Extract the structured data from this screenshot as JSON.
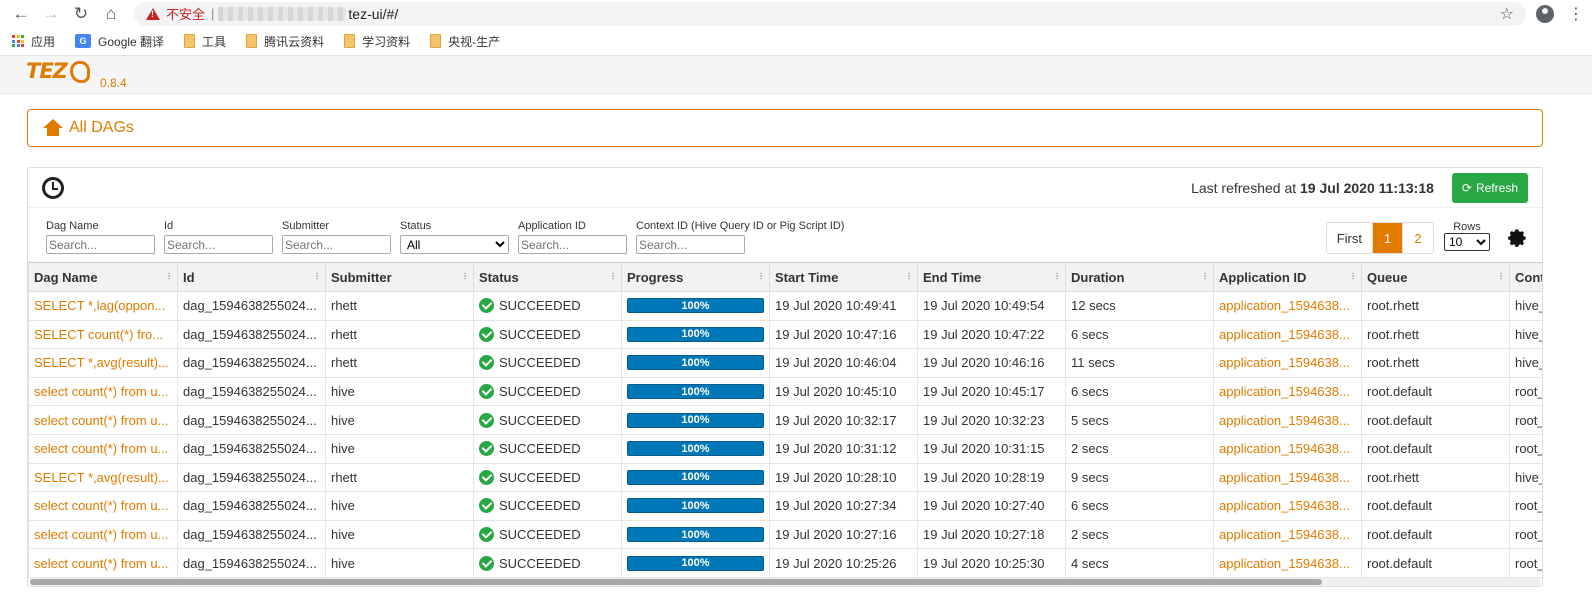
{
  "browser": {
    "insecure_label": "不安全",
    "url": "tez-ui/#/"
  },
  "bookmarks": [
    {
      "label": "应用",
      "icon": "apps-icon"
    },
    {
      "label": "Google 翻译",
      "icon": "google-translate-icon"
    },
    {
      "label": "工具",
      "icon": "folder-icon"
    },
    {
      "label": "腾讯云资料",
      "icon": "folder-icon"
    },
    {
      "label": "学习资料",
      "icon": "folder-icon"
    },
    {
      "label": "央视-生产",
      "icon": "folder-icon"
    }
  ],
  "app": {
    "logo_text": "TEZ",
    "version": "0.8.4"
  },
  "breadcrumb": {
    "title": "All DAGs"
  },
  "toolbar": {
    "last_refreshed_prefix": "Last refreshed at ",
    "last_refreshed_time": "19 Jul 2020 11:13:18",
    "refresh_label": "Refresh"
  },
  "filters": [
    {
      "label": "Dag Name",
      "placeholder": "Search..."
    },
    {
      "label": "Id",
      "placeholder": "Search..."
    },
    {
      "label": "Submitter",
      "placeholder": "Search..."
    },
    {
      "label": "Status",
      "selected": "All"
    },
    {
      "label": "Application ID",
      "placeholder": "Search..."
    },
    {
      "label": "Context ID (Hive Query ID or Pig Script ID)",
      "placeholder": "Search..."
    }
  ],
  "pager": {
    "first_label": "First",
    "current_page": "1",
    "next_page": "2",
    "rows_label": "Rows",
    "rows_value": "10"
  },
  "table": {
    "columns": [
      "Dag Name",
      "Id",
      "Submitter",
      "Status",
      "Progress",
      "Start Time",
      "End Time",
      "Duration",
      "Application ID",
      "Queue",
      "Conte"
    ],
    "rows": [
      {
        "dag_name": "SELECT *,lag(oppon...",
        "id": "dag_1594638255024...",
        "submitter": "rhett",
        "status": "SUCCEEDED",
        "progress": "100%",
        "start": "19 Jul 2020 10:49:41",
        "end": "19 Jul 2020 10:49:54",
        "duration": "12 secs",
        "app_id": "application_1594638...",
        "queue": "root.rhett",
        "context": "hive_"
      },
      {
        "dag_name": "SELECT count(*) fro...",
        "id": "dag_1594638255024...",
        "submitter": "rhett",
        "status": "SUCCEEDED",
        "progress": "100%",
        "start": "19 Jul 2020 10:47:16",
        "end": "19 Jul 2020 10:47:22",
        "duration": "6 secs",
        "app_id": "application_1594638...",
        "queue": "root.rhett",
        "context": "hive_"
      },
      {
        "dag_name": "SELECT *,avg(result)...",
        "id": "dag_1594638255024...",
        "submitter": "rhett",
        "status": "SUCCEEDED",
        "progress": "100%",
        "start": "19 Jul 2020 10:46:04",
        "end": "19 Jul 2020 10:46:16",
        "duration": "11 secs",
        "app_id": "application_1594638...",
        "queue": "root.rhett",
        "context": "hive_"
      },
      {
        "dag_name": "select count(*) from u...",
        "id": "dag_1594638255024...",
        "submitter": "hive",
        "status": "SUCCEEDED",
        "progress": "100%",
        "start": "19 Jul 2020 10:45:10",
        "end": "19 Jul 2020 10:45:17",
        "duration": "6 secs",
        "app_id": "application_1594638...",
        "queue": "root.default",
        "context": "root_"
      },
      {
        "dag_name": "select count(*) from u...",
        "id": "dag_1594638255024...",
        "submitter": "hive",
        "status": "SUCCEEDED",
        "progress": "100%",
        "start": "19 Jul 2020 10:32:17",
        "end": "19 Jul 2020 10:32:23",
        "duration": "5 secs",
        "app_id": "application_1594638...",
        "queue": "root.default",
        "context": "root_"
      },
      {
        "dag_name": "select count(*) from u...",
        "id": "dag_1594638255024...",
        "submitter": "hive",
        "status": "SUCCEEDED",
        "progress": "100%",
        "start": "19 Jul 2020 10:31:12",
        "end": "19 Jul 2020 10:31:15",
        "duration": "2 secs",
        "app_id": "application_1594638...",
        "queue": "root.default",
        "context": "root_"
      },
      {
        "dag_name": "SELECT *,avg(result)...",
        "id": "dag_1594638255024...",
        "submitter": "rhett",
        "status": "SUCCEEDED",
        "progress": "100%",
        "start": "19 Jul 2020 10:28:10",
        "end": "19 Jul 2020 10:28:19",
        "duration": "9 secs",
        "app_id": "application_1594638...",
        "queue": "root.rhett",
        "context": "hive_"
      },
      {
        "dag_name": "select count(*) from u...",
        "id": "dag_1594638255024...",
        "submitter": "hive",
        "status": "SUCCEEDED",
        "progress": "100%",
        "start": "19 Jul 2020 10:27:34",
        "end": "19 Jul 2020 10:27:40",
        "duration": "6 secs",
        "app_id": "application_1594638...",
        "queue": "root.default",
        "context": "root_"
      },
      {
        "dag_name": "select count(*) from u...",
        "id": "dag_1594638255024...",
        "submitter": "hive",
        "status": "SUCCEEDED",
        "progress": "100%",
        "start": "19 Jul 2020 10:27:16",
        "end": "19 Jul 2020 10:27:18",
        "duration": "2 secs",
        "app_id": "application_1594638...",
        "queue": "root.default",
        "context": "root_"
      },
      {
        "dag_name": "select count(*) from u...",
        "id": "dag_1594638255024...",
        "submitter": "hive",
        "status": "SUCCEEDED",
        "progress": "100%",
        "start": "19 Jul 2020 10:25:26",
        "end": "19 Jul 2020 10:25:30",
        "duration": "4 secs",
        "app_id": "application_1594638...",
        "queue": "root.default",
        "context": "root_"
      }
    ]
  },
  "colors": {
    "accent": "#e07b00",
    "success": "#28a745",
    "progress": "#0077b6"
  }
}
